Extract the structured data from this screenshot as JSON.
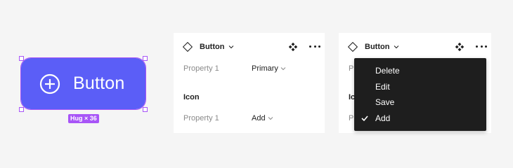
{
  "canvas": {
    "button_label": "Button",
    "hug_badge": "Hug × 36",
    "button_color": "#5b5ef7",
    "selection_color": "#a855f7"
  },
  "panel_left": {
    "component_name": "Button",
    "property1_label": "Property 1",
    "property1_value": "Primary",
    "section_icon": "Icon",
    "icon_property_label": "Property 1",
    "icon_property_value": "Add"
  },
  "panel_right": {
    "component_name": "Button",
    "partial_label_1": "P",
    "partial_label_2": "Ic",
    "partial_label_3": "P"
  },
  "menu": {
    "items": [
      {
        "label": "Delete",
        "checked": false
      },
      {
        "label": "Edit",
        "checked": false
      },
      {
        "label": "Save",
        "checked": false
      },
      {
        "label": "Add",
        "checked": true
      }
    ]
  },
  "icons": {
    "component": "diamond-icon",
    "variants": "four-diamonds-icon",
    "more": "more-dots-icon",
    "chevron": "chevron-down-icon",
    "plus": "plus-circle-icon",
    "check": "check-icon"
  }
}
